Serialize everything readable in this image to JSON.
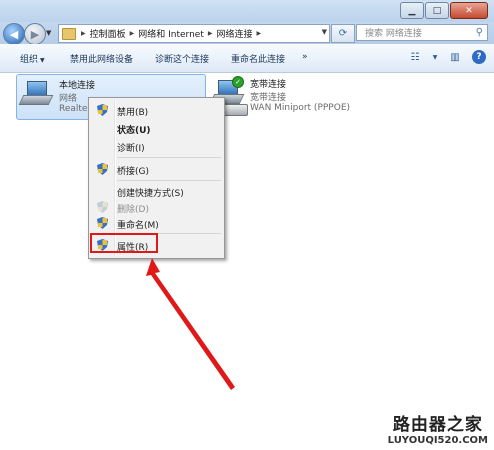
{
  "titlebar": {
    "minimize_glyph": "▁",
    "maximize_glyph": "□",
    "close_glyph": "✕"
  },
  "address": {
    "crumbs": [
      "控制面板",
      "网络和 Internet",
      "网络连接"
    ],
    "refresh_glyph": "⟳",
    "search_placeholder": "搜索 网络连接"
  },
  "commandbar": {
    "organize": "组织",
    "organize_arrow": "▼",
    "disable_device": "禁用此网络设备",
    "diagnose": "诊断这个连接",
    "rename": "重命名此连接",
    "more": "»",
    "help_glyph": "?"
  },
  "connections": [
    {
      "title": "本地连接",
      "status": "网络",
      "device": "Realtek",
      "icon": "network-adapter-icon",
      "selected": true
    },
    {
      "title": "宽带连接",
      "status": "宽带连接",
      "device": "WAN Miniport (PPPOE)",
      "icon": "dialup-modem-icon",
      "selected": false
    }
  ],
  "context_menu": {
    "items": [
      {
        "label": "禁用(B)",
        "shield": true,
        "bold": false,
        "disabled": false
      },
      {
        "label": "状态(U)",
        "shield": false,
        "bold": true,
        "disabled": false
      },
      {
        "label": "诊断(I)",
        "shield": false,
        "bold": false,
        "disabled": false
      },
      {
        "label": "桥接(G)",
        "shield": true,
        "bold": false,
        "disabled": false
      },
      {
        "label": "创建快捷方式(S)",
        "shield": false,
        "bold": false,
        "disabled": false
      },
      {
        "label": "删除(D)",
        "shield": true,
        "bold": false,
        "disabled": true
      },
      {
        "label": "重命名(M)",
        "shield": true,
        "bold": false,
        "disabled": false
      },
      {
        "label": "属性(R)",
        "shield": true,
        "bold": false,
        "disabled": false,
        "highlighted": true
      }
    ]
  },
  "annotation": {
    "color": "#e01818"
  },
  "watermark": {
    "title": "路由器之家",
    "url": "LUYOUQI520.COM"
  },
  "colors": {
    "accent": "#2e6bc4",
    "selection": "#cde2f8",
    "shield_blue": "#3a6fc5",
    "shield_yellow": "#e8c43a",
    "ok_green": "#2aa12a"
  }
}
